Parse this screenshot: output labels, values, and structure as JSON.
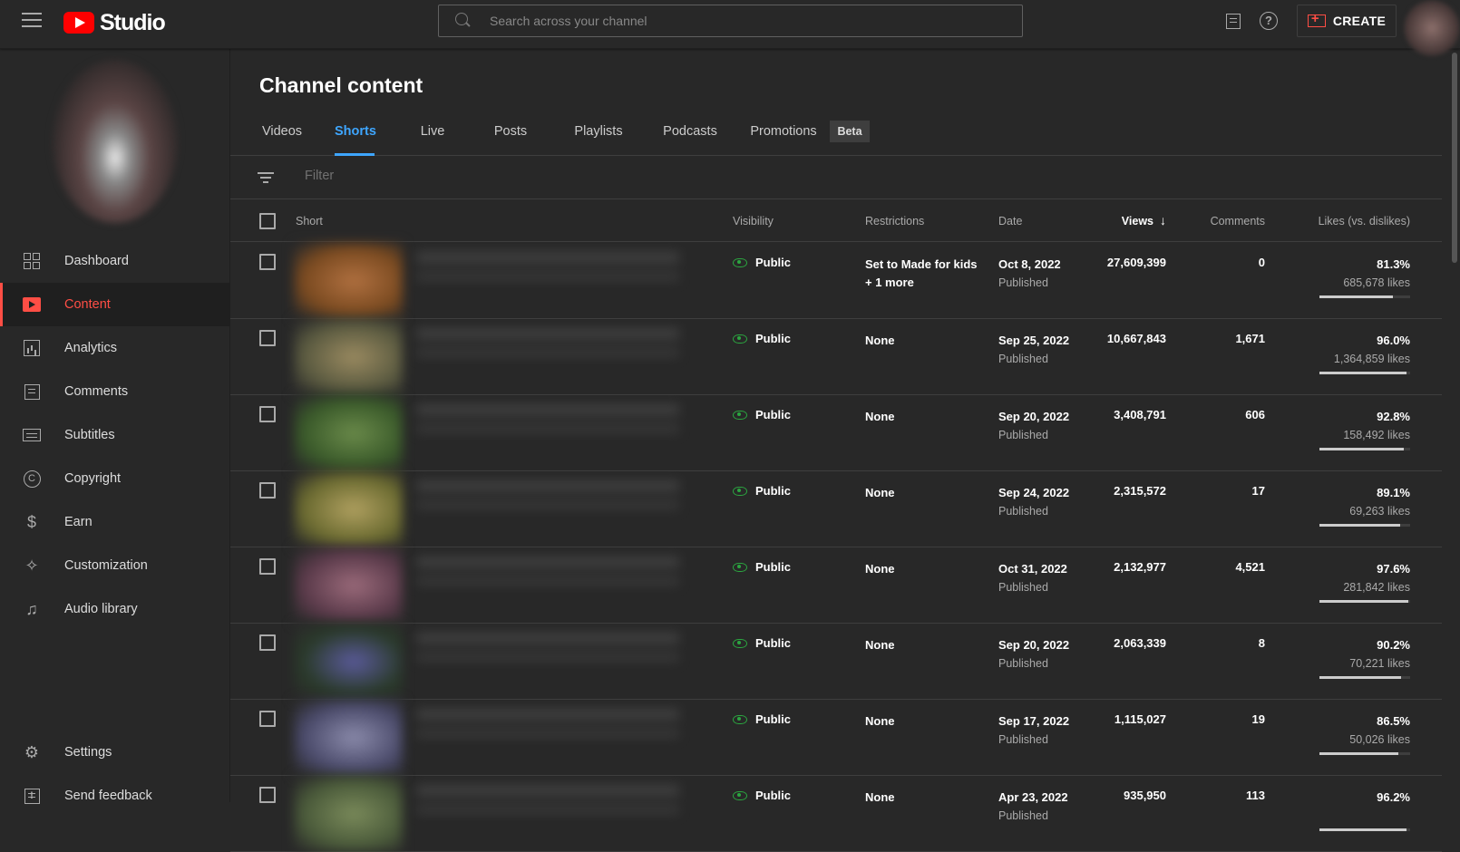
{
  "app": {
    "logo_text": "Studio"
  },
  "search": {
    "placeholder": "Search across your channel"
  },
  "header": {
    "create_label": "CREATE",
    "help_symbol": "?"
  },
  "sidebar": {
    "items": [
      {
        "label": "Dashboard",
        "icon": "dashboard-icon"
      },
      {
        "label": "Content",
        "icon": "content-icon",
        "active": true
      },
      {
        "label": "Analytics",
        "icon": "analytics-icon"
      },
      {
        "label": "Comments",
        "icon": "comments-icon"
      },
      {
        "label": "Subtitles",
        "icon": "subtitles-icon"
      },
      {
        "label": "Copyright",
        "icon": "copyright-icon"
      },
      {
        "label": "Earn",
        "icon": "dollar-icon"
      },
      {
        "label": "Customization",
        "icon": "magic-wand-icon"
      },
      {
        "label": "Audio library",
        "icon": "audio-library-icon"
      }
    ],
    "bottom": [
      {
        "label": "Settings",
        "icon": "gear-icon"
      },
      {
        "label": "Send feedback",
        "icon": "feedback-icon"
      }
    ],
    "icon_glyphs": {
      "copyright": "C",
      "earn": "$",
      "customization": "✧",
      "audio": "♫",
      "settings": "⚙",
      "feedback": "!"
    }
  },
  "main": {
    "title": "Channel content",
    "tabs": [
      "Videos",
      "Shorts",
      "Live",
      "Posts",
      "Playlists",
      "Podcasts",
      "Promotions"
    ],
    "active_tab": "Shorts",
    "beta_badge": "Beta",
    "filter_placeholder": "Filter",
    "columns": {
      "short": "Short",
      "visibility": "Visibility",
      "restrictions": "Restrictions",
      "date": "Date",
      "views": "Views",
      "views_sort_arrow": "↓",
      "comments": "Comments",
      "likes": "Likes (vs. dislikes)"
    },
    "rows": [
      {
        "visibility": "Public",
        "restrictions": "Set to Made for kids",
        "restrictions_more": "+ 1 more",
        "date": "Oct 8, 2022",
        "status": "Published",
        "views": "27,609,399",
        "comments": "0",
        "likes_pct": "81.3%",
        "likes_count": "685,678 likes",
        "likes_ratio": 0.813,
        "thumb_colors": [
          "#7a4a20",
          "#b07040"
        ]
      },
      {
        "visibility": "Public",
        "restrictions": "None",
        "restrictions_more": "",
        "date": "Sep 25, 2022",
        "status": "Published",
        "views": "10,667,843",
        "comments": "1,671",
        "likes_pct": "96.0%",
        "likes_count": "1,364,859 likes",
        "likes_ratio": 0.96,
        "thumb_colors": [
          "#5a5a40",
          "#9a8a60"
        ]
      },
      {
        "visibility": "Public",
        "restrictions": "None",
        "restrictions_more": "",
        "date": "Sep 20, 2022",
        "status": "Published",
        "views": "3,408,791",
        "comments": "606",
        "likes_pct": "92.8%",
        "likes_count": "158,492 likes",
        "likes_ratio": 0.928,
        "thumb_colors": [
          "#3a5a2a",
          "#6a8a4a"
        ]
      },
      {
        "visibility": "Public",
        "restrictions": "None",
        "restrictions_more": "",
        "date": "Sep 24, 2022",
        "status": "Published",
        "views": "2,315,572",
        "comments": "17",
        "likes_pct": "89.1%",
        "likes_count": "69,263 likes",
        "likes_ratio": 0.891,
        "thumb_colors": [
          "#6a6a30",
          "#b0a060"
        ]
      },
      {
        "visibility": "Public",
        "restrictions": "None",
        "restrictions_more": "",
        "date": "Oct 31, 2022",
        "status": "Published",
        "views": "2,132,977",
        "comments": "4,521",
        "likes_pct": "97.6%",
        "likes_count": "281,842 likes",
        "likes_ratio": 0.976,
        "thumb_colors": [
          "#5a3a4a",
          "#9a6a7a"
        ]
      },
      {
        "visibility": "Public",
        "restrictions": "None",
        "restrictions_more": "",
        "date": "Sep 20, 2022",
        "status": "Published",
        "views": "2,063,339",
        "comments": "8",
        "likes_pct": "90.2%",
        "likes_count": "70,221 likes",
        "likes_ratio": 0.902,
        "thumb_colors": [
          "#2a3a2a",
          "#5a5a9a"
        ]
      },
      {
        "visibility": "Public",
        "restrictions": "None",
        "restrictions_more": "",
        "date": "Sep 17, 2022",
        "status": "Published",
        "views": "1,115,027",
        "comments": "19",
        "likes_pct": "86.5%",
        "likes_count": "50,026 likes",
        "likes_ratio": 0.865,
        "thumb_colors": [
          "#4a4a6a",
          "#8a8aaa"
        ]
      },
      {
        "visibility": "Public",
        "restrictions": "None",
        "restrictions_more": "",
        "date": "Apr 23, 2022",
        "status": "Published",
        "views": "935,950",
        "comments": "113",
        "likes_pct": "96.2%",
        "likes_count": "",
        "likes_ratio": 0.962,
        "thumb_colors": [
          "#4a5a3a",
          "#7a8a5a"
        ]
      }
    ]
  },
  "colors": {
    "accent_red": "#ff4e45",
    "tab_blue": "#3ea6ff",
    "public_green": "#2ba640",
    "bg": "#282828"
  }
}
